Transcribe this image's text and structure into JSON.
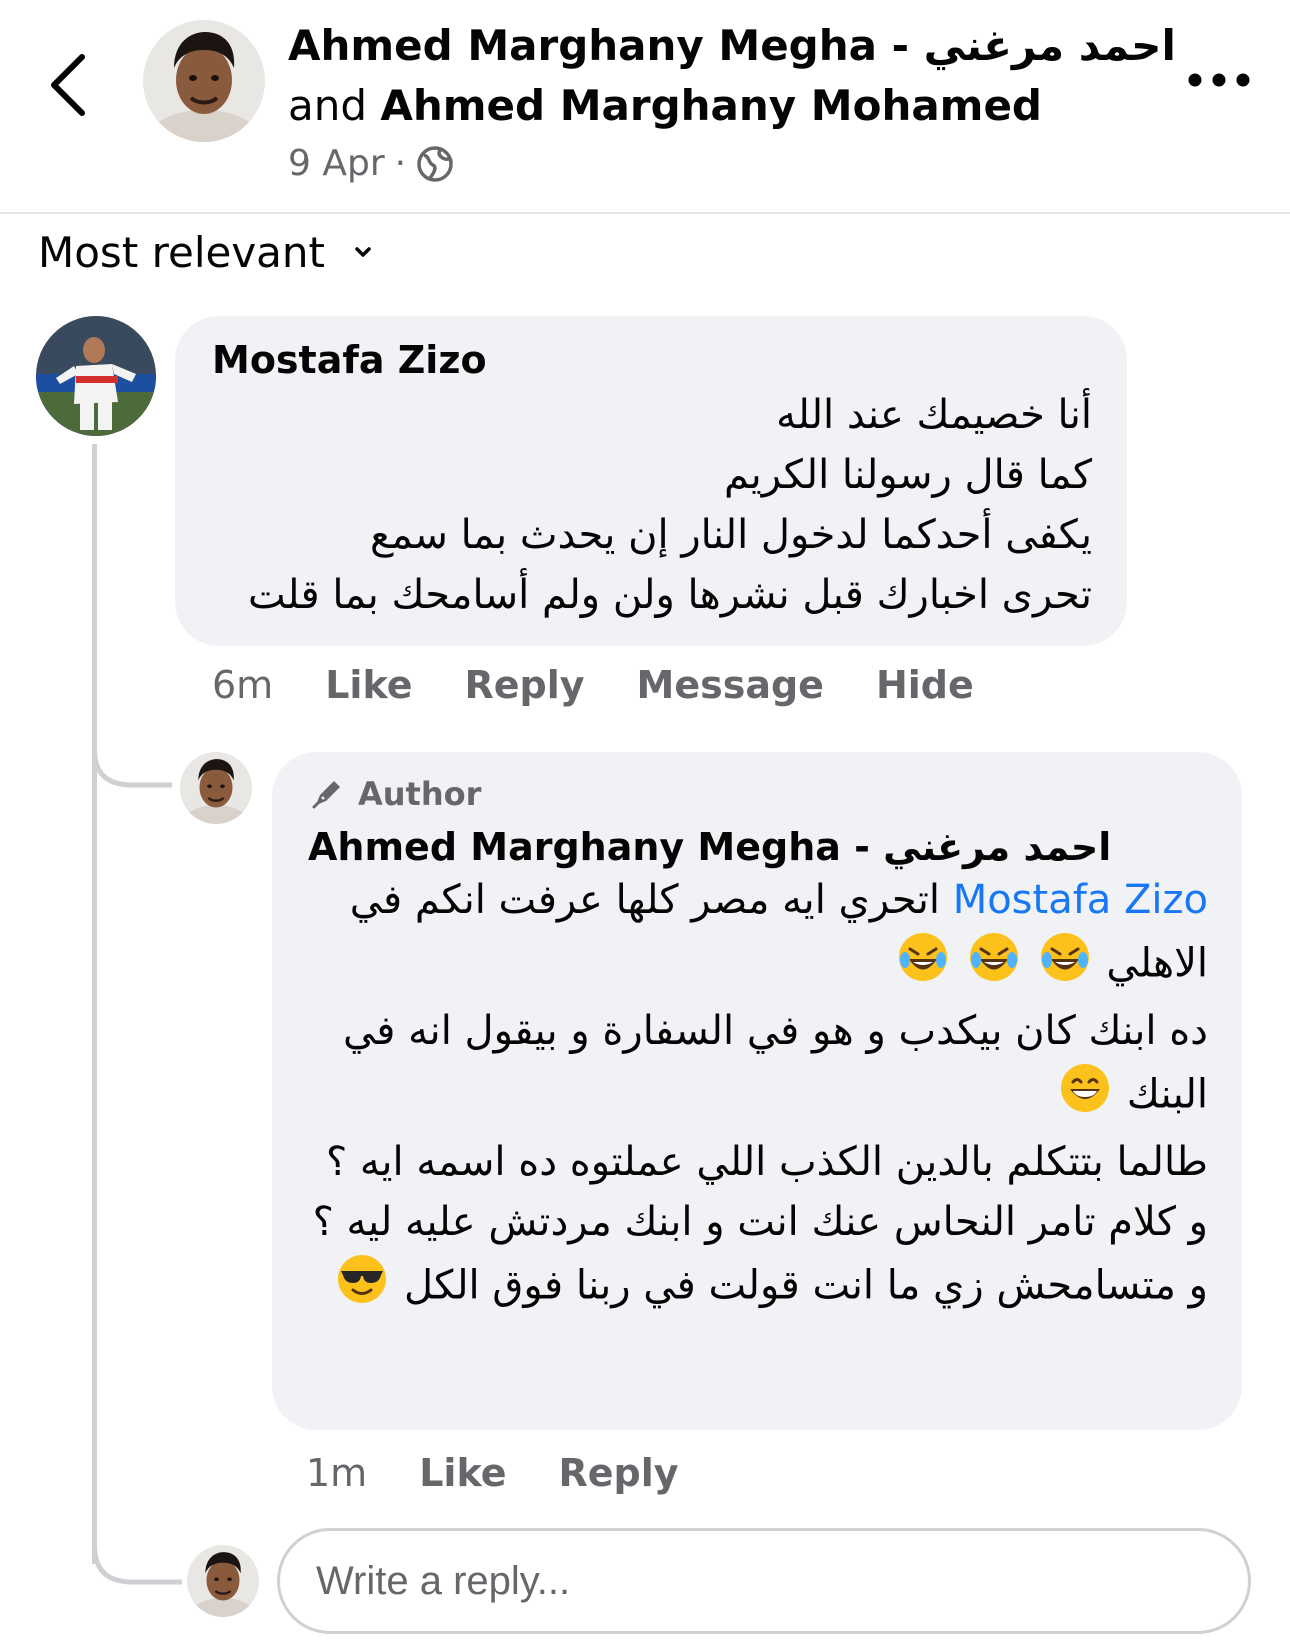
{
  "header": {
    "primary_name": "Ahmed Marghany Megha - احمد مرغني",
    "connector": "and",
    "secondary_name": "Ahmed Marghany Mohamed",
    "date": "9 Apr",
    "separator": "·",
    "audience_icon": "globe-icon",
    "more_icon": "more-horizontal-icon"
  },
  "sort": {
    "label": "Most relevant",
    "icon": "chevron-down-icon"
  },
  "comment": {
    "author": "Mostafa Zizo",
    "lines": [
      "أنا خصيمك عند الله",
      "كما قال رسولنا الكريم",
      "يكفى أحدكما لدخول النار إن يحدث بما سمع",
      "تحرى اخبارك قبل نشرها ولن ولم أسامحك بما قلت"
    ],
    "time": "6m",
    "actions": {
      "like": "Like",
      "reply": "Reply",
      "message": "Message",
      "hide": "Hide"
    }
  },
  "reply": {
    "badge": "Author",
    "badge_icon": "author-pen-icon",
    "author": "Ahmed Marghany Megha - احمد مرغني",
    "mention": "Mostafa Zizo",
    "line1": "اتحري ايه مصر كلها عرفت انكم في الاهلي",
    "line2": "ده ابنك كان بيكدب و هو في السفارة و بيقول انه في البنك",
    "line3": "طالما بتتكلم بالدين الكذب اللي عملتوه ده اسمه ايه ؟",
    "line4": "و كلام تامر النحاس عنك انت و ابنك مردتش عليه ليه ؟",
    "line5": "و متسامحش زي ما انت قولت في ربنا فوق الكل",
    "emojis": [
      "laughing-tears-emoji",
      "grinning-emoji",
      "sunglasses-emoji"
    ],
    "time": "1m",
    "actions": {
      "like": "Like",
      "reply": "Reply"
    }
  },
  "composer": {
    "placeholder": "Write a reply..."
  },
  "colors": {
    "mention": "#1877f2",
    "bubble": "#f0f2f5",
    "secondary_text": "#65676b",
    "thread_line": "#ced0d4"
  }
}
